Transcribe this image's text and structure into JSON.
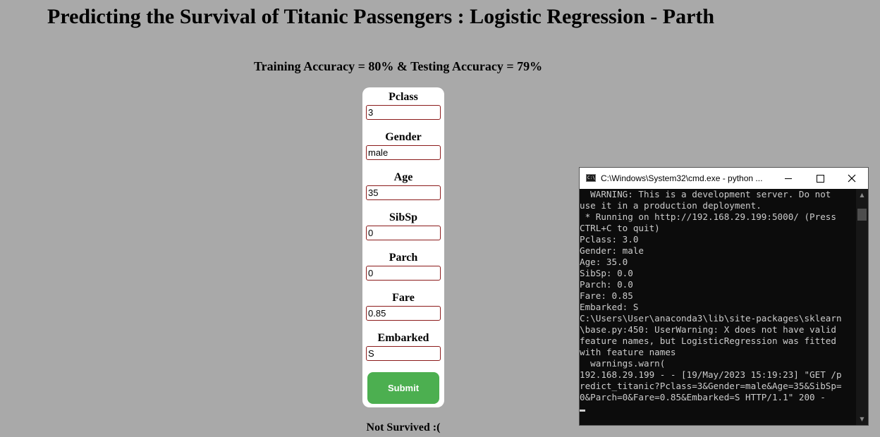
{
  "page": {
    "title": "Predicting the Survival of Titanic Passengers : Logistic Regression - Parth",
    "accuracy": "Training Accuracy = 80% & Testing Accuracy = 79%",
    "result": "Not Survived :("
  },
  "form": {
    "fields": [
      {
        "label": "Pclass",
        "value": "3"
      },
      {
        "label": "Gender",
        "value": "male"
      },
      {
        "label": "Age",
        "value": "35"
      },
      {
        "label": "SibSp",
        "value": "0"
      },
      {
        "label": "Parch",
        "value": "0"
      },
      {
        "label": "Fare",
        "value": "0.85"
      },
      {
        "label": "Embarked",
        "value": "S"
      }
    ],
    "submit_label": "Submit"
  },
  "colors": {
    "page_background": "#a9a9a9",
    "card_background": "#ffffff",
    "submit_button": "#4caf50",
    "input_border": "#8b1a1a",
    "terminal_background": "#0c0c0c",
    "terminal_text": "#cccccc"
  },
  "cmd": {
    "title": "C:\\Windows\\System32\\cmd.exe - python ...",
    "app_icon_text": "C:\\",
    "icons": {
      "minimize": "minimize-icon",
      "maximize": "maximize-icon",
      "close": "close-icon"
    },
    "lines": [
      "  WARNING: This is a development server. Do not",
      "use it in a production deployment.",
      " * Running on http://192.168.29.199:5000/ (Press",
      "CTRL+C to quit)",
      "Pclass: 3.0",
      "Gender: male",
      "Age: 35.0",
      "SibSp: 0.0",
      "Parch: 0.0",
      "Fare: 0.85",
      "Embarked: S",
      "C:\\Users\\User\\anaconda3\\lib\\site-packages\\sklearn",
      "\\base.py:450: UserWarning: X does not have valid",
      "feature names, but LogisticRegression was fitted",
      "with feature names",
      "  warnings.warn(",
      "192.168.29.199 - - [19/May/2023 15:19:23] \"GET /p",
      "redict_titanic?Pclass=3&Gender=male&Age=35&SibSp=",
      "0&Parch=0&Fare=0.85&Embarked=S HTTP/1.1\" 200 -"
    ]
  }
}
